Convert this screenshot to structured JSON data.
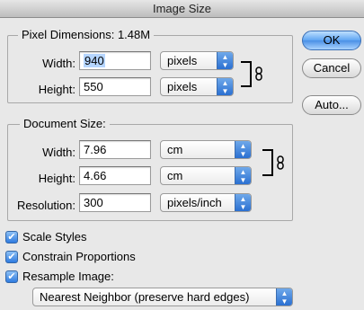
{
  "window": {
    "title": "Image Size"
  },
  "pixel_dimensions": {
    "title": "Pixel Dimensions:",
    "size": "1.48M",
    "width_label": "Width:",
    "width_value": "940",
    "width_unit": "pixels",
    "height_label": "Height:",
    "height_value": "550",
    "height_unit": "pixels"
  },
  "document_size": {
    "title": "Document Size:",
    "width_label": "Width:",
    "width_value": "7.96",
    "width_unit": "cm",
    "height_label": "Height:",
    "height_value": "4.66",
    "height_unit": "cm",
    "resolution_label": "Resolution:",
    "resolution_value": "300",
    "resolution_unit": "pixels/inch"
  },
  "buttons": {
    "ok": "OK",
    "cancel": "Cancel",
    "auto": "Auto..."
  },
  "options": {
    "scale_styles": "Scale Styles",
    "constrain_proportions": "Constrain Proportions",
    "resample_image": "Resample Image:",
    "resample_method": "Nearest Neighbor (preserve hard edges)"
  },
  "icons": {
    "checkmark": "✔",
    "link": "chain-link-icon",
    "popup_arrows": "up-down-arrows-icon"
  }
}
